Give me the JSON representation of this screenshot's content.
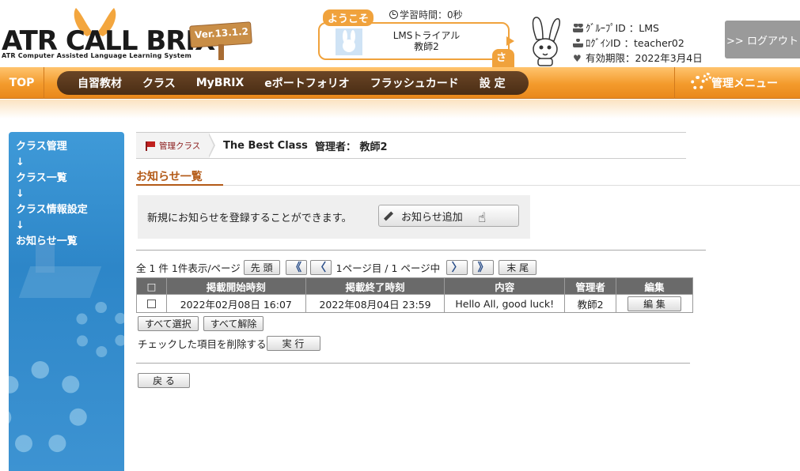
{
  "header": {
    "logo_text": "ATR CALL BRIX",
    "logo_subtitle": "ATR Computer Assisted Language Learning System",
    "version": "Ver.13.1.2",
    "welcome_label": "ようこそ",
    "study_time": "学習時間：0秒",
    "user_display_name_line1": "LMSトライアル",
    "user_display_name_line2": "教師2",
    "honorific": "さん",
    "group_id": "ｸﾞﾙｰﾌﾟID ：LMS",
    "login_id": "ﾛｸﾞｲﾝID ：teacher02",
    "expiry": "有効期限：2022年3月4日",
    "logout_label": ">> ログアウト"
  },
  "nav": {
    "top_label": "TOP",
    "items": [
      "自習教材",
      "クラス",
      "MyBRIX",
      "eポートフォリオ",
      "フラッシュカード",
      "設 定"
    ],
    "admin_label": "管理メニュー"
  },
  "sidebar": {
    "links": [
      "クラス管理",
      "↓",
      "クラス一覧",
      "↓",
      "クラス情報設定",
      "↓",
      "お知らせ一覧"
    ]
  },
  "breadcrumb": {
    "section": "管理クラス",
    "class_name": "The Best Class",
    "admin": "管理者： 教師2"
  },
  "page": {
    "title": "お知らせ一覧",
    "info_text": "新規にお知らせを登録することができます。",
    "add_button": "お知らせ追加"
  },
  "pager": {
    "summary": "全 1 件 1件表示/ページ",
    "first_label": "先 頭",
    "page_info": "1ページ目 / 1 ページ中",
    "last_label": "末 尾",
    "prev_prev": "《",
    "prev": "〈",
    "next": "〉",
    "next_next": "》"
  },
  "table": {
    "headers": [
      "□",
      "掲載開始時刻",
      "掲載終了時刻",
      "内容",
      "管理者",
      "編集"
    ],
    "rows": [
      {
        "start": "2022年02月08日 16:07",
        "end": "2022年08月04日 23:59",
        "content": "Hello All, good luck!",
        "admin": "教師2",
        "edit_label": "編 集"
      }
    ]
  },
  "actions": {
    "select_all": "すべて選択",
    "deselect_all": "すべて解除",
    "delete_text": "チェックした項目を削除する",
    "execute": "実 行",
    "back": "戻 る"
  },
  "colors": {
    "accent_orange": "#f39a2c",
    "nav_brown": "#5a3a1c",
    "sidebar_blue": "#2d86c8",
    "title_brown": "#b35a17"
  }
}
